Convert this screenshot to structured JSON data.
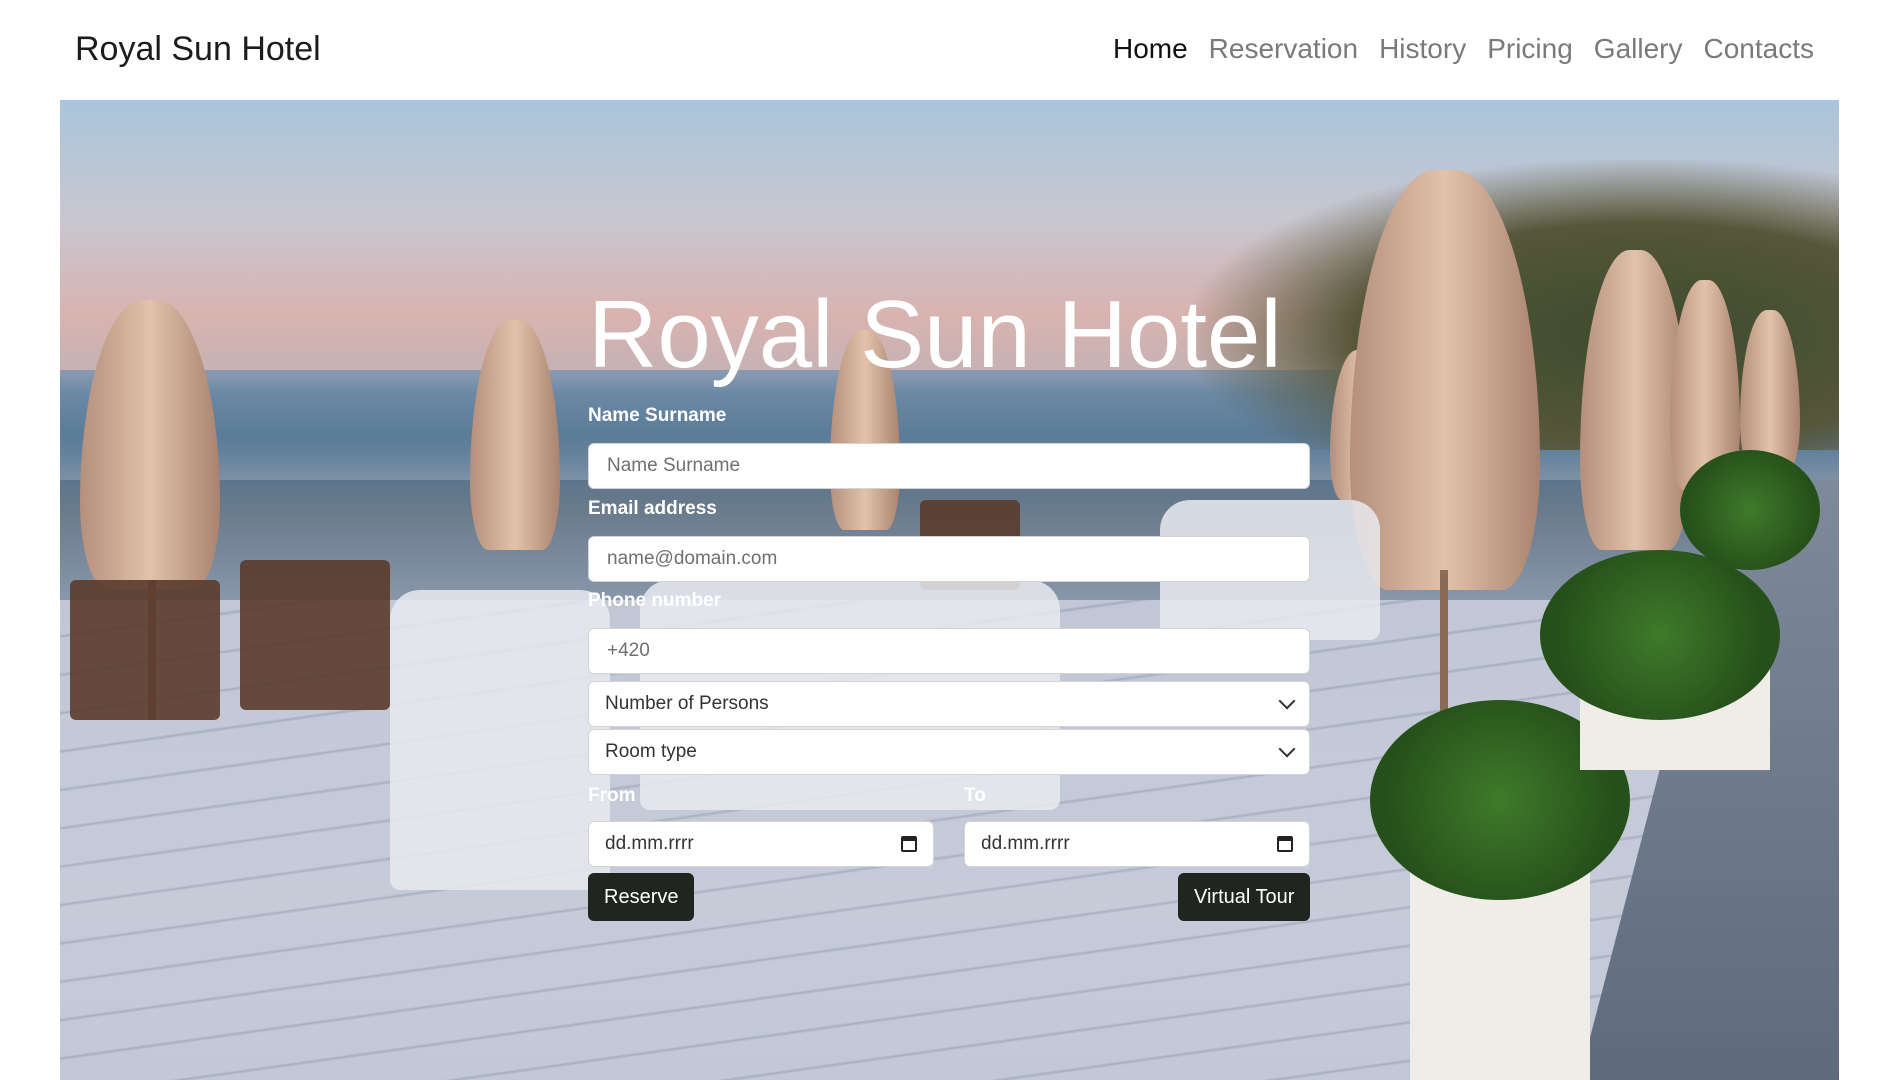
{
  "brand": "Royal Sun Hotel",
  "nav": {
    "items": [
      {
        "label": "Home",
        "active": true
      },
      {
        "label": "Reservation"
      },
      {
        "label": "History"
      },
      {
        "label": "Pricing"
      },
      {
        "label": "Gallery"
      },
      {
        "label": "Contacts"
      }
    ]
  },
  "hero": {
    "title": "Royal Sun Hotel"
  },
  "form": {
    "name_label": "Name Surname",
    "name_placeholder": "Name Surname",
    "email_label": "Email address",
    "email_placeholder": "name@domain.com",
    "phone_label": "Phone number",
    "phone_placeholder": "+420",
    "persons_select": "Number of Persons",
    "room_select": "Room type",
    "from_label": "From",
    "to_label": "To",
    "from_value": "dd.mm.rrrr",
    "to_value": "dd.mm.rrrr",
    "reserve_label": "Reserve",
    "tour_label": "Virtual Tour"
  },
  "colors": {
    "button_bg": "#212520",
    "nav_active": "#111111",
    "nav_inactive": "#7a7a7a"
  },
  "icons": [
    "chevron-down-icon",
    "calendar-icon"
  ]
}
